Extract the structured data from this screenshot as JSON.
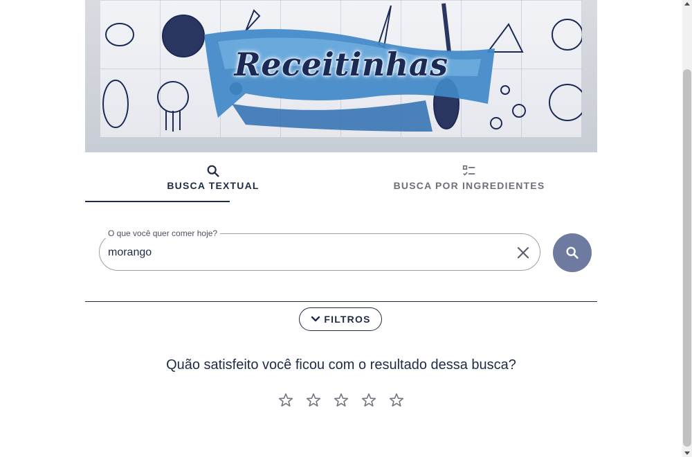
{
  "banner": {
    "logo_text": "Receitinhas",
    "colors": {
      "ribbon": "#3f88c8",
      "ink": "#1b2a55"
    }
  },
  "tabs": [
    {
      "label": "BUSCA TEXTUAL",
      "icon": "search-icon",
      "active": true
    },
    {
      "label": "BUSCA POR INGREDIENTES",
      "icon": "checklist-icon",
      "active": false
    }
  ],
  "search": {
    "legend": "O que você quer comer hoje?",
    "value": "morango",
    "clear_icon": "close-icon",
    "submit_icon": "search-icon",
    "submit_color": "#6e7aa0"
  },
  "filters": {
    "label": "FILTROS",
    "icon": "chevron-down-icon"
  },
  "rating": {
    "question": "Quão satisfeito você ficou com o resultado dessa busca?",
    "max": 5,
    "value": 0
  },
  "colors": {
    "primary": "#1f2a44",
    "inactive": "#6c7077"
  }
}
